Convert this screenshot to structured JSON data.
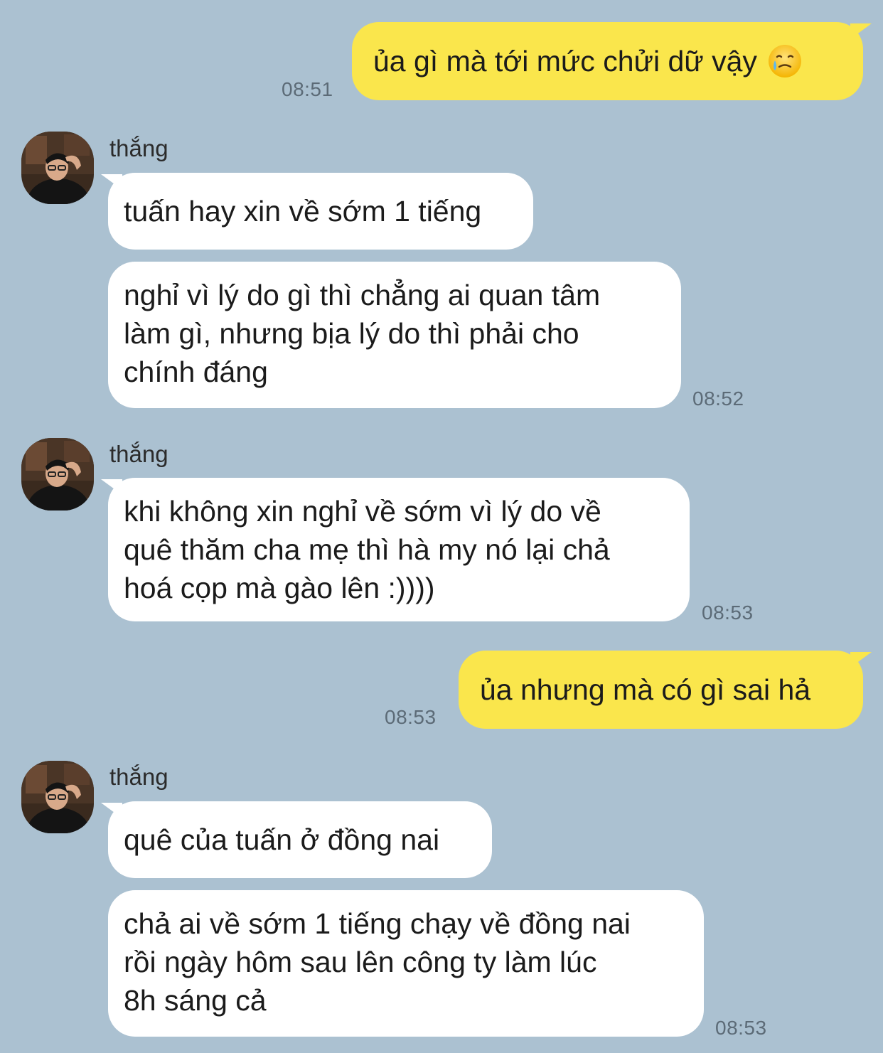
{
  "messages": [
    {
      "sender": "me",
      "text": "ủa gì mà tới mức chửi dữ vậy",
      "emoji": "crying-face-icon",
      "time": "08:51"
    },
    {
      "sender": "thắng",
      "text": "tuấn hay xin về sớm 1 tiếng"
    },
    {
      "sender": "thắng",
      "lines": [
        "nghỉ vì lý do gì thì chẳng ai quan tâm",
        "làm gì, nhưng bịa lý do thì phải cho",
        "chính đáng"
      ],
      "time": "08:52"
    },
    {
      "sender": "thắng",
      "lines": [
        "khi không xin nghỉ về sớm vì lý do về",
        "quê thăm cha mẹ thì hà my nó lại chả",
        "hoá cọp mà gào lên :))))"
      ],
      "time": "08:53"
    },
    {
      "sender": "me",
      "text": "ủa nhưng mà có gì sai hả",
      "time": "08:53"
    },
    {
      "sender": "thắng",
      "text": "quê của tuấn ở đồng nai"
    },
    {
      "sender": "thắng",
      "lines": [
        "chả ai về sớm 1 tiếng chạy về đồng nai",
        "rồi ngày hôm sau lên công ty làm lúc",
        "8h sáng cả"
      ],
      "time": "08:53"
    }
  ],
  "contact": {
    "name": "thắng",
    "avatar_icon": "contact-avatar"
  },
  "colors": {
    "background": "#abc1d1",
    "my_bubble": "#fae64c",
    "their_bubble": "#ffffff"
  }
}
